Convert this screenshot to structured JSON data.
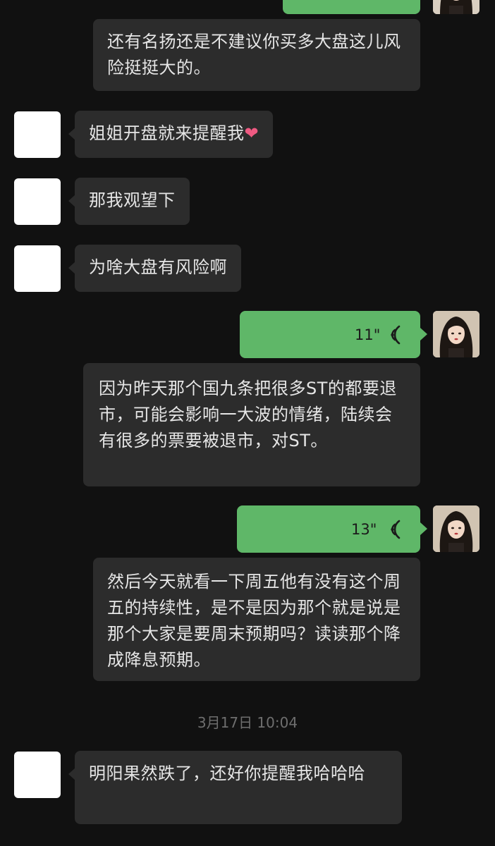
{
  "messages": [
    {
      "type": "voice-out-top",
      "duration": ""
    },
    {
      "type": "text-out",
      "text": "还有名扬还是不建议你买多大盘这儿风险挺挺大的。"
    },
    {
      "type": "text-in",
      "text": "姐姐开盘就来提醒我",
      "emoji": "❤"
    },
    {
      "type": "text-in",
      "text": "那我观望下"
    },
    {
      "type": "text-in",
      "text": "为啥大盘有风险啊"
    },
    {
      "type": "voice-out",
      "duration": "11\""
    },
    {
      "type": "text-out",
      "text": "因为昨天那个国九条把很多ST的都要退市，可能会影响一大波的情绪，陆续会有很多的票要被退市，对ST。"
    },
    {
      "type": "voice-out",
      "duration": "13\""
    },
    {
      "type": "text-out",
      "text": "然后今天就看一下周五他有没有这个周五的持续性，是不是因为那个就是说是那个大家是要周末预期吗？读读那个降成降息预期。"
    },
    {
      "type": "text-in",
      "text": "明阳果然跌了，还好你提醒我哈哈哈"
    }
  ],
  "timestamp": "3月17日 10:04",
  "colors": {
    "background": "#111111",
    "bubble_in": "#2c2c2c",
    "bubble_out_voice": "#5fb768",
    "text": "#e6e6e6"
  }
}
